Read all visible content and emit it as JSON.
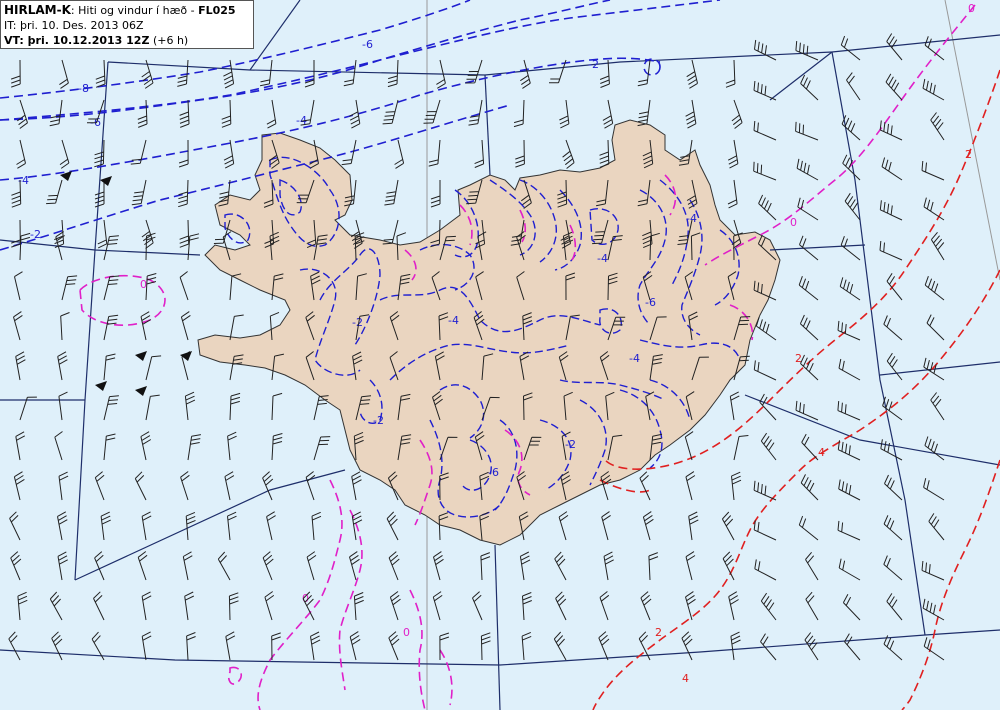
{
  "header": {
    "model": "HIRLAM-K",
    "separator": ":",
    "description": "Hiti og vindur í hæð -",
    "level": "FL025",
    "it_line": "IT: þri. 10. Des. 2013 06Z",
    "vt_label": "VT: þri. 10.12.2013 12Z",
    "vt_offset": "(+6 h)"
  },
  "contours": {
    "negative_color": "#1f1fd0",
    "zero_color": "#e020c8",
    "positive_color": "#e02020",
    "labels": [
      "-8",
      "-6",
      "-6",
      "-4",
      "-4",
      "-2",
      "-2",
      "-2",
      "-4",
      "-6",
      "-4",
      "-4",
      "-2",
      "-6",
      "-4",
      "-2",
      "0",
      "0",
      "0",
      "0",
      "0",
      "2",
      "2",
      "2",
      "4",
      "4"
    ]
  },
  "colors": {
    "sea": "#dff0fa",
    "land": "#ead5c0",
    "grid": "#1e2e6a"
  }
}
